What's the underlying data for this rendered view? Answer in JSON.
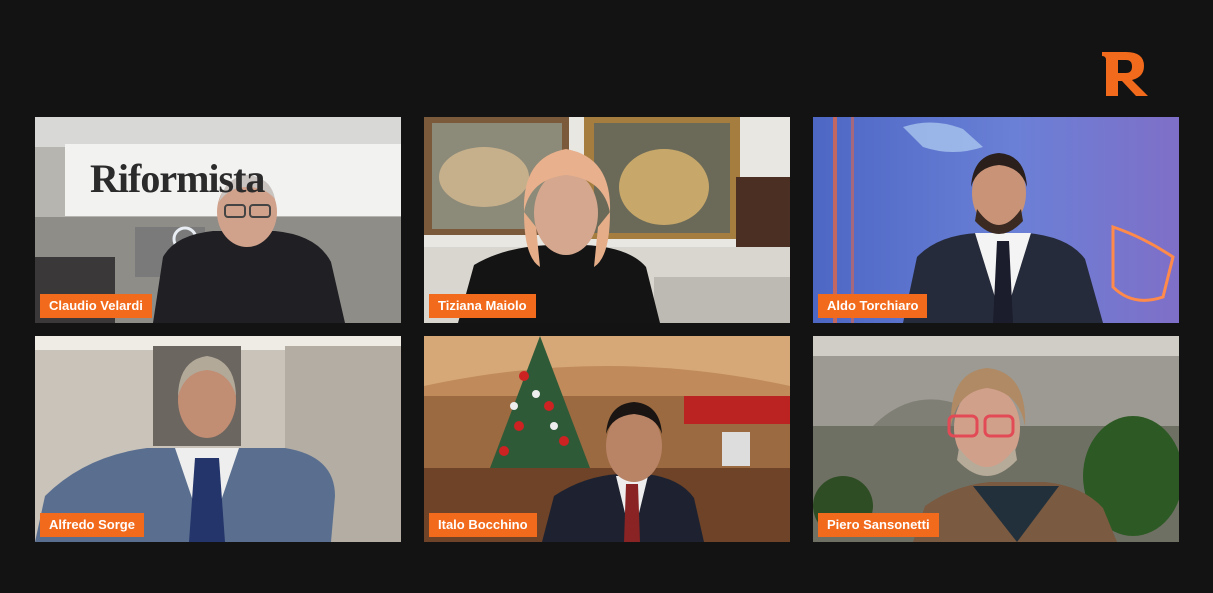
{
  "brand": {
    "logo_icon": "riformista-r-logo",
    "accent_color": "#f26a1b"
  },
  "tiles": [
    {
      "participant": "Claudio Velardi",
      "background_text": "Riformista"
    },
    {
      "participant": "Tiziana Maiolo"
    },
    {
      "participant": "Aldo Torchiaro"
    },
    {
      "participant": "Alfredo Sorge"
    },
    {
      "participant": "Italo Bocchino"
    },
    {
      "participant": "Piero Sansonetti"
    }
  ]
}
